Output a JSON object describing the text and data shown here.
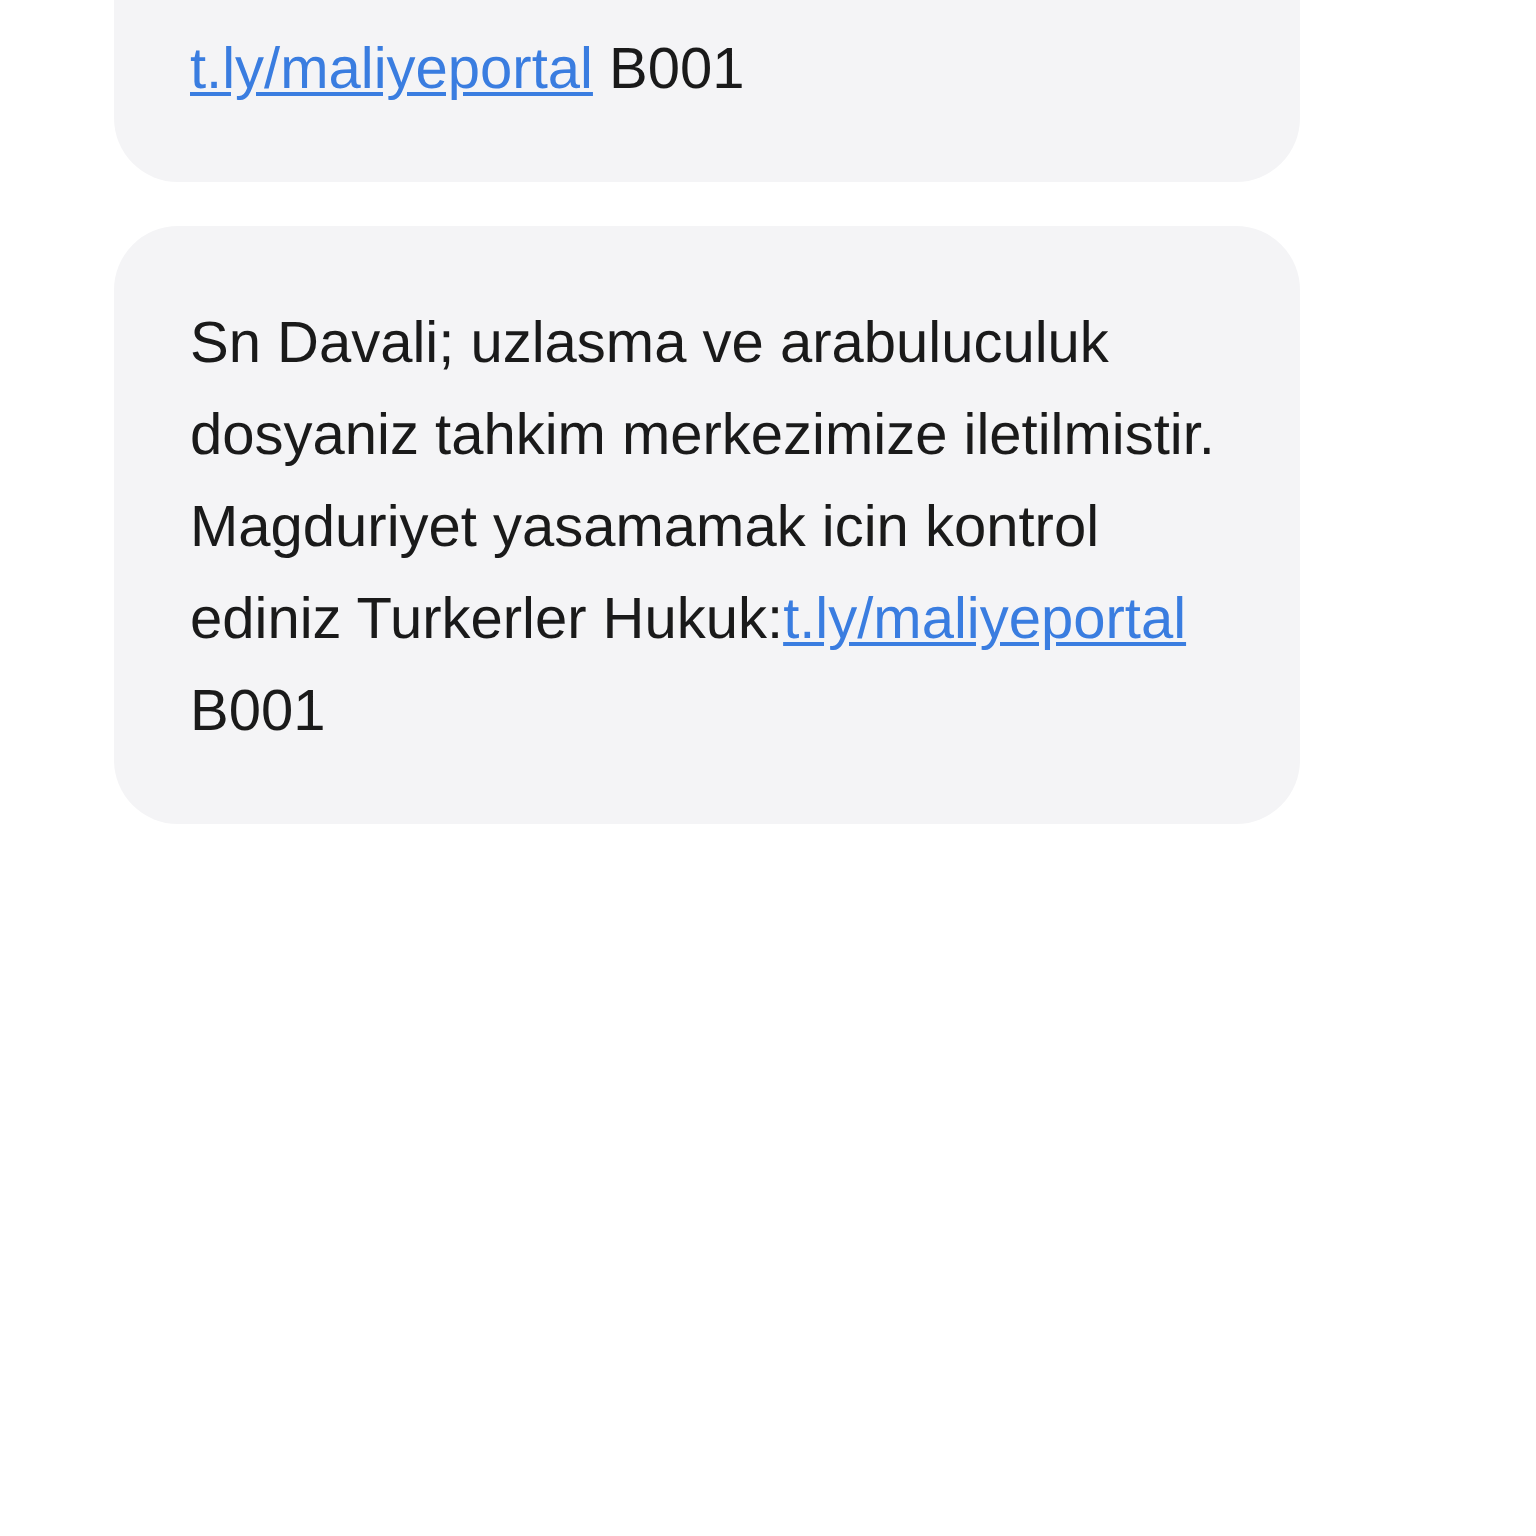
{
  "messages": [
    {
      "link": "t.ly/maliyeportal",
      "code": "B001"
    },
    {
      "text": "Sn Davali; uzlasma ve arabuluculuk dosyaniz tahkim merkezimize iletilmistir. Magduriyet yasamamak icin kontrol ediniz Turkerler Hukuk:",
      "link": "t.ly/maliyeportal",
      "code": "B001"
    }
  ]
}
